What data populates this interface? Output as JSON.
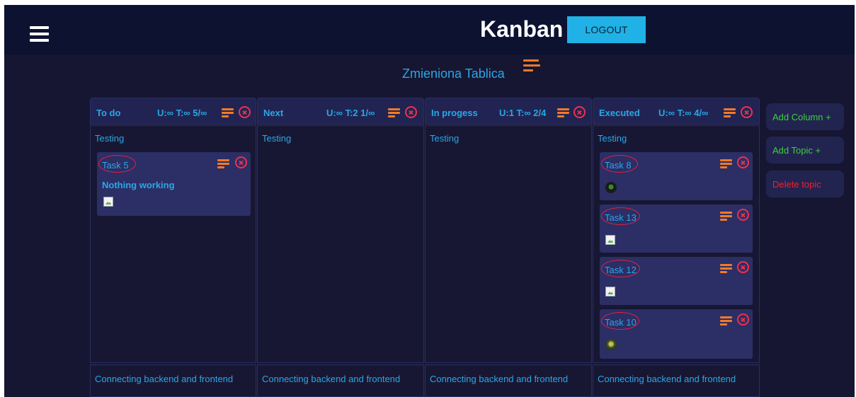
{
  "header": {
    "app_title": "Kanban",
    "logout_label": "LOGOUT",
    "menu_icon": "hamburger-icon"
  },
  "board": {
    "title": "Zmieniona Tablica",
    "menu_icon": "lines-icon"
  },
  "columns": [
    {
      "name": "To do",
      "limits": "U:∞  T:∞  5/∞",
      "topic": "Testing",
      "footer_topic": "Connecting backend and frontend"
    },
    {
      "name": "Next",
      "limits": "U:∞  T:2  1/∞",
      "topic": "Testing",
      "footer_topic": "Connecting backend and frontend"
    },
    {
      "name": "In progess",
      "limits": "U:1  T:∞  2/4",
      "topic": "Testing",
      "footer_topic": "Connecting backend and frontend"
    },
    {
      "name": "Executed",
      "limits": "U:∞  T:∞  4/∞",
      "topic": "Testing",
      "footer_topic": "Connecting backend and frontend"
    }
  ],
  "tasks": {
    "todo": [
      {
        "title": "Task 5",
        "description": "Nothing working",
        "image": "broken-image-icon"
      }
    ],
    "executed": [
      {
        "title": "Task 8",
        "image": "avatar"
      },
      {
        "title": "Task 13",
        "image": "broken-image-icon"
      },
      {
        "title": "Task 12",
        "image": "broken-image-icon"
      },
      {
        "title": "Task 10",
        "image": "avatar"
      }
    ]
  },
  "side_actions": {
    "add_column": "Add Column +",
    "add_topic": "Add Topic +",
    "delete_topic": "Delete topic"
  },
  "colors": {
    "accent_blue": "#2aa7e6",
    "logout_bg": "#20b2e6",
    "icon_orange": "#f07a28",
    "icon_red": "#f0304a",
    "add_green": "#3ad13a",
    "delete_red": "#f0202a",
    "background": "#161632",
    "header_bg": "#0c1230",
    "task_bg": "#2c2e66"
  }
}
